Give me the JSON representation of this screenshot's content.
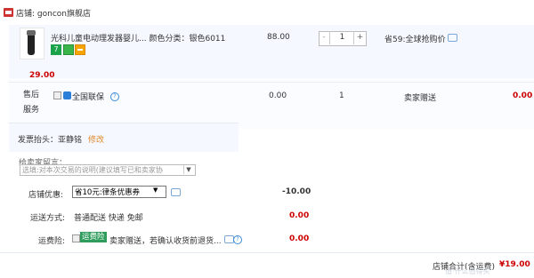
{
  "shop": {
    "label": "店铺: goncon旗舰店"
  },
  "item": {
    "title": "光科儿童电动理发器婴儿...",
    "color_label": "颜色分类：银色6011",
    "badge_seven": "7",
    "price": "88.00",
    "quantity": "1",
    "qty_minus": "-",
    "qty_plus": "+",
    "promo": "省59:全球抢购价",
    "subtotal": "29.00"
  },
  "service": {
    "label": "售后服务",
    "national": "全国联保",
    "value_a": "0.00",
    "count": "1",
    "seller_gift": "卖家赠送",
    "value_b": "0.00"
  },
  "invoice": {
    "label": "发票抬头：亚静铭",
    "edit": "修改"
  },
  "message": {
    "label": "给卖家留言：",
    "placeholder": "选填:对本次交易的说明(建议填写已和卖家协"
  },
  "discount": {
    "label": "店铺优惠:",
    "selected": "省10元:律条优惠券",
    "value": "-10.00"
  },
  "shipping": {
    "label": "运送方式:",
    "text": "普通配送 快递 免邮",
    "value": "0.00"
  },
  "insurance": {
    "label": "运费险:",
    "tag": "运费险",
    "text": "卖家赠送，若确认收货前退货...",
    "value": "0.00"
  },
  "total": {
    "label": "店铺合计(含运费)",
    "value": "¥19.00"
  },
  "watermark": "值·什么值得买"
}
